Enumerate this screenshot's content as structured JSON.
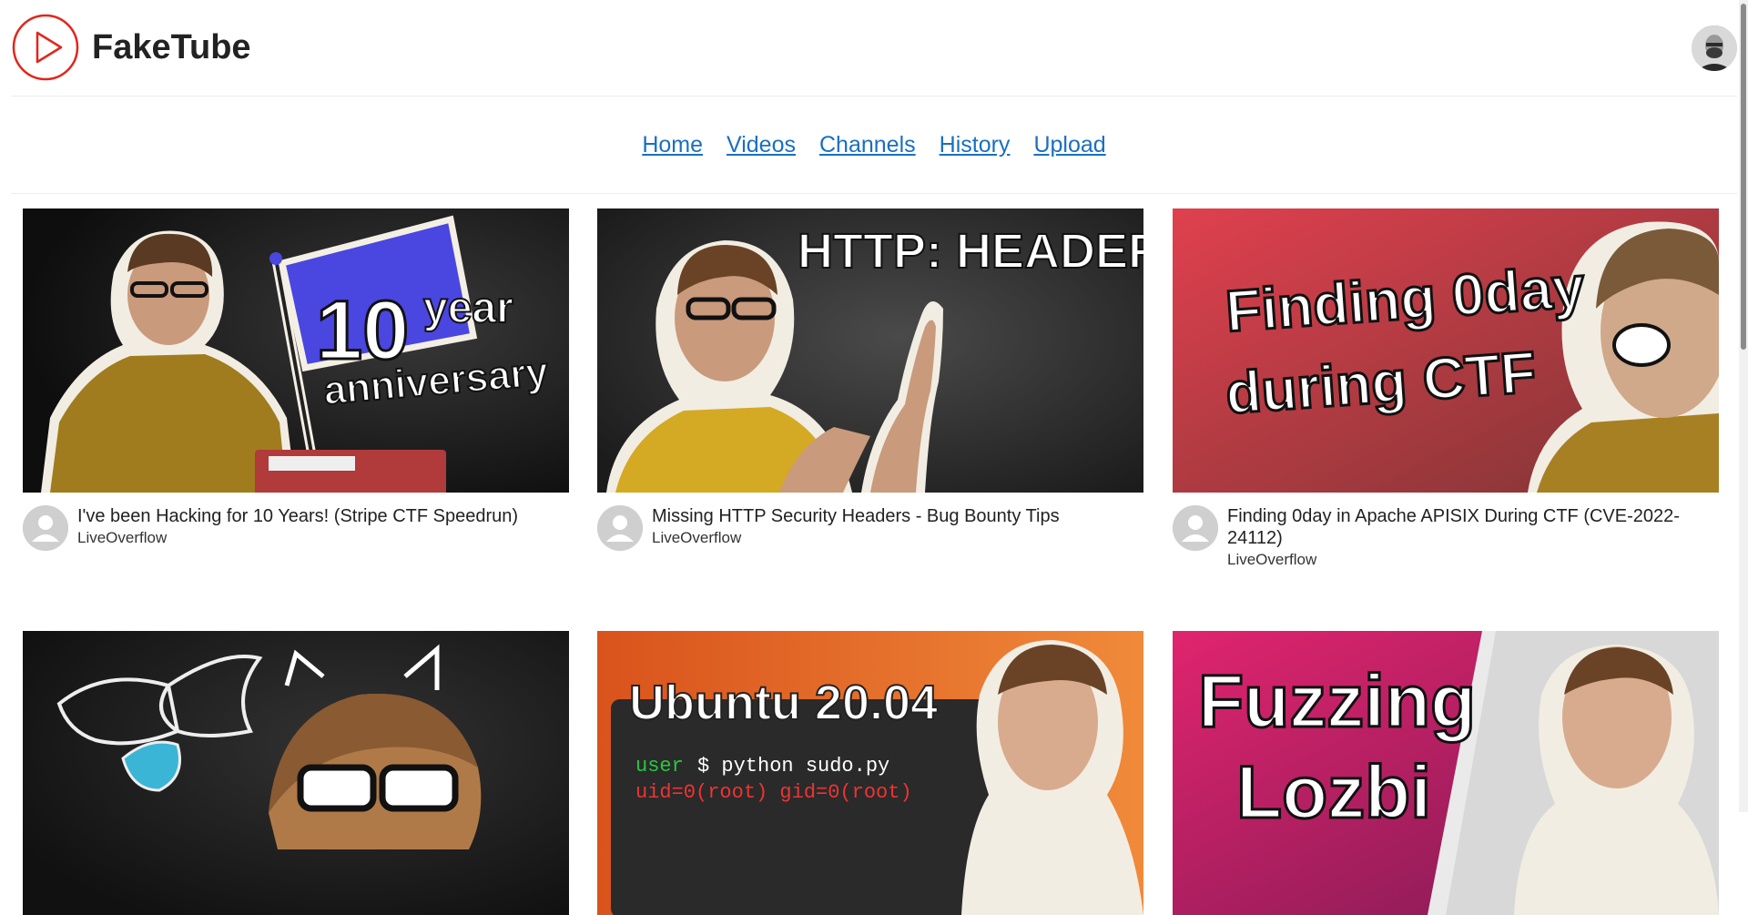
{
  "app": {
    "name": "FakeTube"
  },
  "nav": [
    "Home",
    "Videos",
    "Channels",
    "History",
    "Upload"
  ],
  "videos": [
    {
      "title": "I've been Hacking for 10 Years! (Stripe CTF Speedrun)",
      "channel": "LiveOverflow",
      "thumb_text": [
        "10",
        "year",
        "anniversary"
      ]
    },
    {
      "title": "Missing HTTP Security Headers - Bug Bounty Tips",
      "channel": "LiveOverflow",
      "thumb_text": [
        "HTTP: HEADER"
      ]
    },
    {
      "title": "Finding 0day in Apache APISIX During CTF (CVE-2022-24112)",
      "channel": "LiveOverflow",
      "thumb_text": [
        "Finding 0day",
        "during CTF"
      ]
    },
    {
      "title": "",
      "channel": "",
      "thumb_text": []
    },
    {
      "title": "",
      "channel": "",
      "thumb_text": [
        "Ubuntu 20.04",
        "user",
        "$ python sudo.py",
        "uid=0(root) gid=0(root)"
      ]
    },
    {
      "title": "",
      "channel": "",
      "thumb_text": [
        "Fuzzing",
        "Lozbi"
      ]
    }
  ],
  "colors": {
    "brand_red": "#e1261c",
    "link": "#1a6fc1"
  }
}
